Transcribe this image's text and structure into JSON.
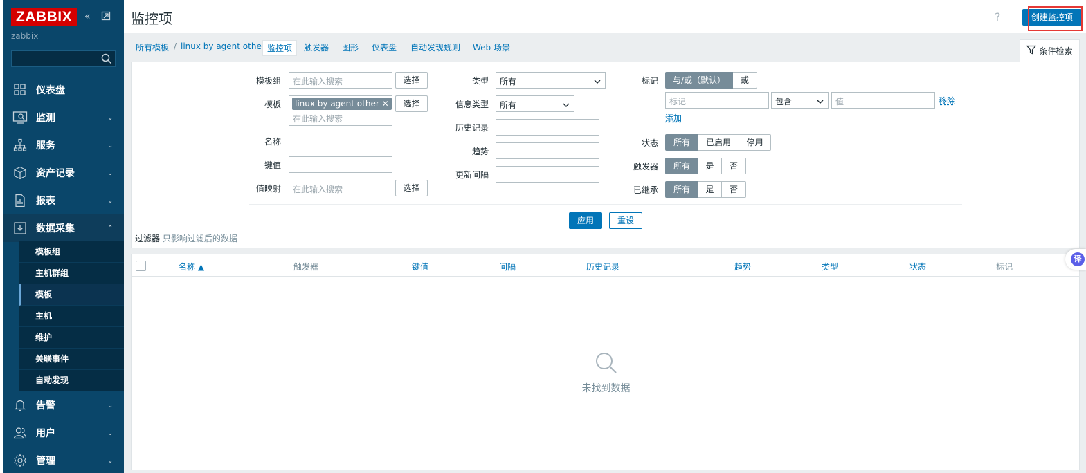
{
  "sidebar": {
    "logo": "ZABBIX",
    "server_name": "zabbix",
    "search_placeholder": "",
    "nav": [
      {
        "label": "仪表盘",
        "icon": "dashboard-icon"
      },
      {
        "label": "监测",
        "icon": "monitoring-icon"
      },
      {
        "label": "服务",
        "icon": "services-icon"
      },
      {
        "label": "资产记录",
        "icon": "inventory-icon"
      },
      {
        "label": "报表",
        "icon": "reports-icon"
      },
      {
        "label": "数据采集",
        "icon": "data-collection-icon"
      },
      {
        "label": "告警",
        "icon": "bell-icon"
      },
      {
        "label": "用户",
        "icon": "users-icon"
      },
      {
        "label": "管理",
        "icon": "gear-icon"
      }
    ],
    "submenu": [
      "模板组",
      "主机群组",
      "模板",
      "主机",
      "维护",
      "关联事件",
      "自动发现"
    ],
    "active_sub": "模板"
  },
  "header": {
    "title": "监控项",
    "help": "?",
    "create_button": "创建监控项"
  },
  "tabs": {
    "crumb_all_templates": "所有模板",
    "crumb_sep": "/",
    "crumb_template": "linux by agent other",
    "items": "监控项",
    "triggers": "触发器",
    "graphs": "图形",
    "dashboards": "仪表盘",
    "discovery": "自动发现规则",
    "web": "Web 场景",
    "filter_toggle": "条件检索"
  },
  "filter": {
    "template_group_label": "模板组",
    "template_group_placeholder": "在此输入搜索",
    "select": "选择",
    "template_label": "模板",
    "template_chip": "linux by agent other",
    "template_placeholder": "在此输入搜索",
    "name_label": "名称",
    "key_label": "键值",
    "value_map_label": "值映射",
    "value_map_placeholder": "在此输入搜索",
    "type_label": "类型",
    "type_value": "所有",
    "info_type_label": "信息类型",
    "info_type_value": "所有",
    "history_label": "历史记录",
    "trends_label": "趋势",
    "interval_label": "更新间隔",
    "tags_label": "标记",
    "tags_and_or": "与/或（默认）",
    "tags_or": "或",
    "tag_placeholder": "标记",
    "tag_operator": "包含",
    "tag_value_placeholder": "值",
    "remove": "移除",
    "add": "添加",
    "state_label": "状态",
    "state_options": [
      "所有",
      "已启用",
      "停用"
    ],
    "triggers_label": "触发器",
    "triggers_options": [
      "所有",
      "是",
      "否"
    ],
    "inherited_label": "已继承",
    "inherited_options": [
      "所有",
      "是",
      "否"
    ],
    "apply": "应用",
    "reset": "重设",
    "note_main": "过滤器",
    "note_sub": "只影响过滤后的数据"
  },
  "table": {
    "columns": [
      "名称 ▲",
      "触发器",
      "键值",
      "间隔",
      "历史记录",
      "趋势",
      "类型",
      "状态",
      "标记"
    ],
    "empty": "未找到数据"
  },
  "translate_badge": "译"
}
